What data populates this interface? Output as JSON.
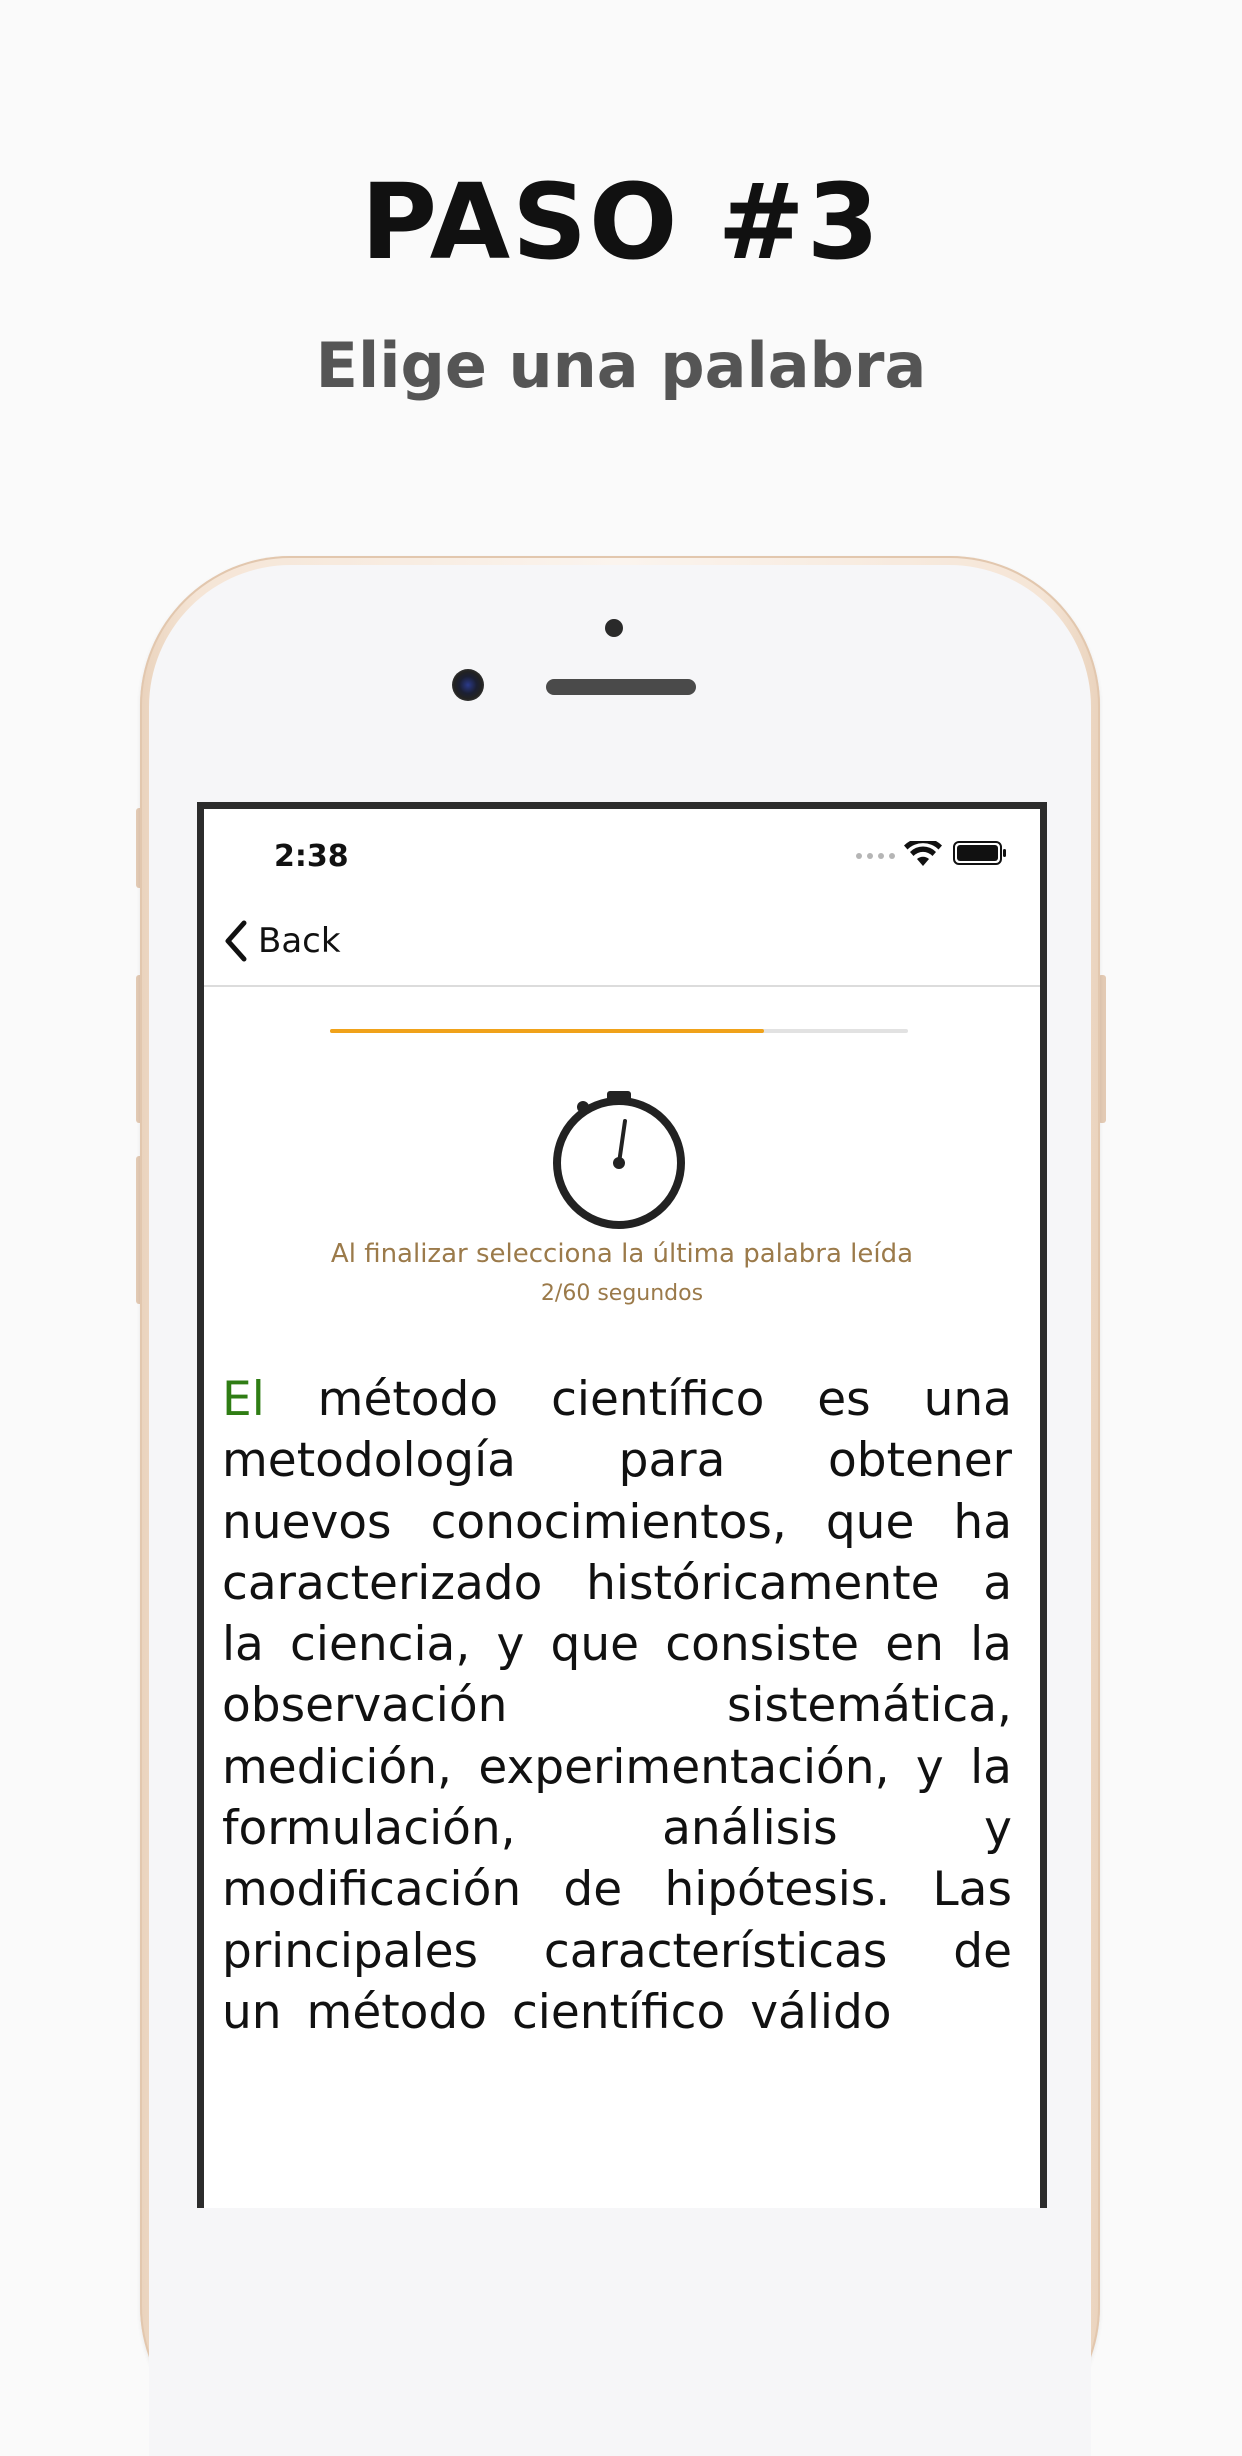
{
  "hero": {
    "title": "PASO #3",
    "subtitle": "Elige una palabra"
  },
  "status_bar": {
    "time": "2:38",
    "icons": [
      "signal-dots-icon",
      "wifi-icon",
      "battery-icon"
    ]
  },
  "nav": {
    "back_label": "Back"
  },
  "progress": {
    "fraction": 0.75,
    "track_color": "#e2e2e2",
    "fill_color": "#f0a21a"
  },
  "timer": {
    "icon": "stopwatch-icon",
    "instruction": "Al finalizar selecciona la última palabra leída",
    "elapsed_text": "2/60 segundos"
  },
  "reading": {
    "highlight_color": "#2f7d14",
    "current_word_index": 0,
    "words": [
      "El",
      "método",
      "científico",
      "es",
      "una",
      "metodología",
      "para",
      "obtener",
      "nuevos",
      "conocimientos,",
      "que",
      "ha",
      "caracterizado",
      "históricamente",
      "a",
      "la",
      "ciencia,",
      "y",
      "que",
      "consiste",
      "en",
      "la",
      "observación",
      "sistemática,",
      "medición,",
      "experimentación,",
      "y",
      "la",
      "formulación,",
      "análisis",
      "y",
      "modificación",
      "de",
      "hipótesis.",
      "Las",
      "principales",
      "características",
      "de",
      "un",
      "método",
      "científico",
      "válido"
    ]
  }
}
